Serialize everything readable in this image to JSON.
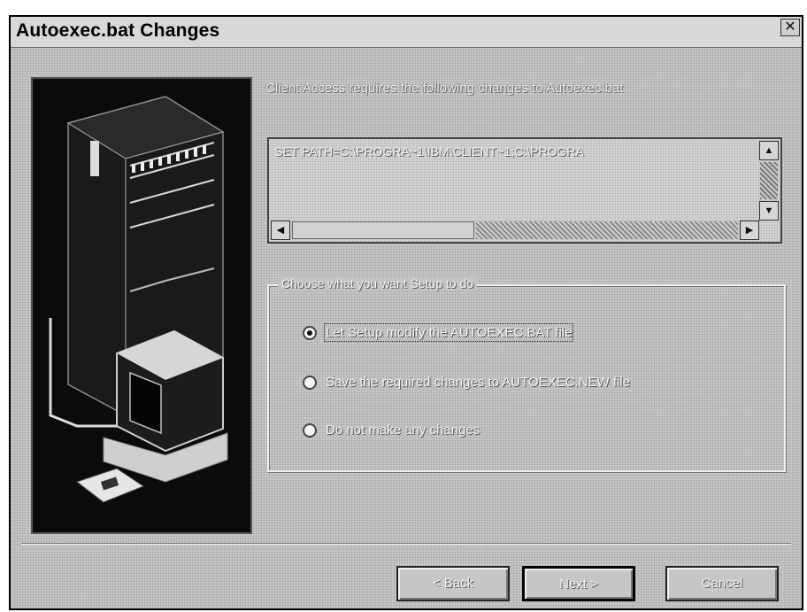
{
  "window": {
    "title": "Autoexec.bat Changes",
    "close_label": "✕"
  },
  "prompt": "Client Access requires the following changes to Autoexec.bat",
  "changes_box": {
    "line": "SET PATH=C:\\PROGRA~1\\IBM\\CLIENT~1;C:\\PROGRA"
  },
  "group": {
    "legend": "Choose what you want Setup to do",
    "options": [
      {
        "label": "Let Setup modify the AUTOEXEC.BAT file",
        "checked": true
      },
      {
        "label": "Save the required changes to AUTOEXEC.NEW file",
        "checked": false
      },
      {
        "label": "Do not make any changes",
        "checked": false
      }
    ]
  },
  "buttons": {
    "back": "< Back",
    "next": "Next >",
    "cancel": "Cancel"
  },
  "icons": {
    "scroll_up": "up-arrow-icon",
    "scroll_down": "down-arrow-icon",
    "scroll_left": "left-arrow-icon",
    "scroll_right": "right-arrow-icon"
  },
  "colors": {
    "dialog_bg": "#c3c3c3",
    "illustration_bg": "#0d0d0d",
    "text_light": "#f4f4f4"
  }
}
